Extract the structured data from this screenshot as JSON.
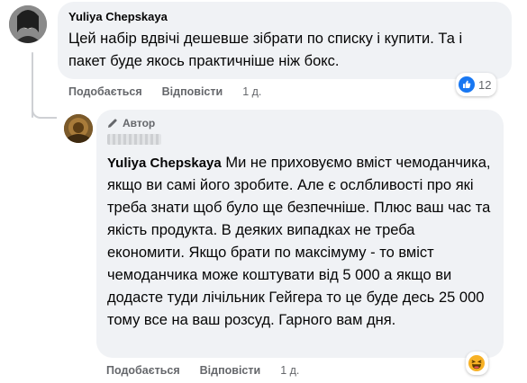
{
  "comments": [
    {
      "author": "Yuliya Chepskaya",
      "text": "Цей набір вдвічі дешевше зібрати по списку і купити. Та і пакет буде якось практичніше ніж бокс.",
      "actions": {
        "like": "Подобається",
        "reply": "Відповісти",
        "time": "1 д."
      },
      "reactions": {
        "icon": "like-icon",
        "count": "12",
        "color": "#1877f2"
      }
    },
    {
      "badge": "Автор",
      "badge_icon": "pencil-icon",
      "mention": "Yuliya Chepskaya",
      "text": " Ми не приховуємо вміст чемоданчика, якщо ви самі його зробите. Але є ослбливості про які треба знати щоб було ще безпечніше. Плюс ваш час та якість продукта. В деяких випадках не треба економити. Якщо брати по максімуму - то вміст чемоданчика може коштувати від 5 000 а якщо ви додасте туди лічільник Гейгера то це буде десь 25 000 тому все на ваш розсуд. Гарного вам дня.",
      "actions": {
        "like": "Подобається",
        "reply": "Відповісти",
        "time": "1 д."
      },
      "reactions": {
        "icon": "haha-icon"
      }
    }
  ]
}
